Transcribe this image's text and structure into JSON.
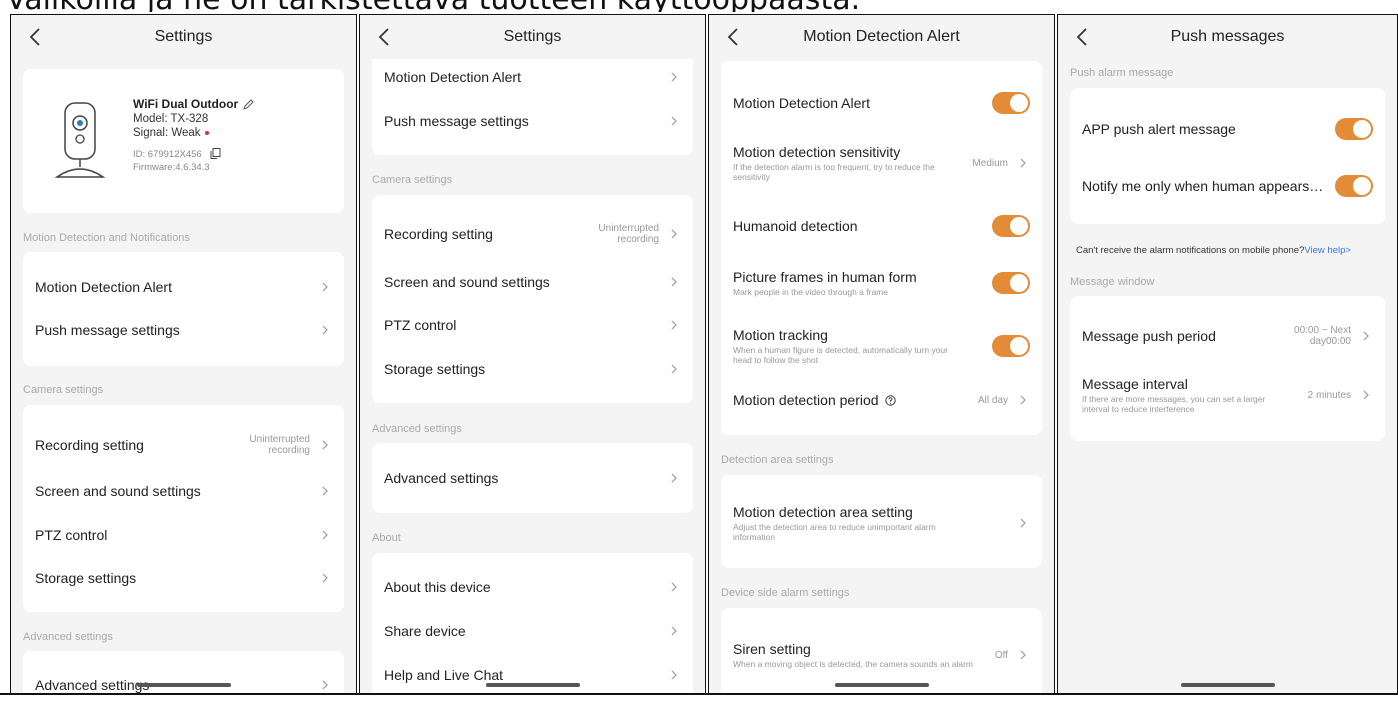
{
  "caption": "Valikoilla ja ne on tarkistettava tuotteen käyttöoppaasta.",
  "screens": {
    "s1": {
      "title": "Settings",
      "device": {
        "name": "WiFi Dual Outdoor",
        "model": "Model: TX-328",
        "signal": "Signal: Weak",
        "id": "ID: 679912X456",
        "firmware": "Firmware:4.6.34.3"
      },
      "sections": [
        "Motion Detection and Notifications",
        "Camera settings",
        "Advanced settings"
      ],
      "items": {
        "motion": "Motion Detection Alert",
        "push": "Push message settings",
        "recording": "Recording setting",
        "recording_value": "Uninterrupted recording",
        "screen": "Screen and sound settings",
        "ptz": "PTZ control",
        "storage": "Storage settings",
        "advanced": "Advanced settings"
      }
    },
    "s2": {
      "title": "Settings",
      "sections": [
        "Camera settings",
        "Advanced settings",
        "About"
      ],
      "items": {
        "motion": "Motion Detection Alert",
        "push": "Push message settings",
        "recording": "Recording setting",
        "recording_value": "Uninterrupted recording",
        "screen": "Screen and sound settings",
        "ptz": "PTZ control",
        "storage": "Storage settings",
        "advanced": "Advanced settings",
        "about": "About this device",
        "share": "Share device",
        "help": "Help and Live Chat"
      }
    },
    "s3": {
      "title": "Motion Detection Alert",
      "sections": [
        "Detection area settings",
        "Device side alarm settings"
      ],
      "items": {
        "alert": "Motion Detection Alert",
        "sensitivity": "Motion detection sensitivity",
        "sensitivity_sub": "If the detection alarm is too frequent, try to reduce the sensitivity",
        "sensitivity_value": "Medium",
        "humanoid": "Humanoid detection",
        "frames": "Picture frames in human form",
        "frames_sub": "Mark people in the video through a frame",
        "tracking": "Motion tracking",
        "tracking_sub": "When a human figure is detected, automatically turn your head to follow the shot",
        "period": "Motion detection period",
        "period_value": "All day",
        "area": "Motion detection area setting",
        "area_sub": "Adjust the detection area to reduce unimportant alarm information",
        "siren": "Siren setting",
        "siren_sub": "When a moving object is detected, the camera sounds an alarm",
        "siren_value": "Off"
      },
      "toggles": {
        "alert": true,
        "humanoid": true,
        "frames": true,
        "tracking": true
      }
    },
    "s4": {
      "title": "Push messages",
      "sections": [
        "Push alarm message",
        "Message window"
      ],
      "items": {
        "app_push": "APP push alert message",
        "notify_human": "Notify me only when human appears o...",
        "help_text": "Can't receive the alarm notifications on mobile phone?",
        "help_link": "View help>",
        "push_period": "Message push period",
        "push_period_value": "00:00 ~ Next day00:00",
        "interval": "Message interval",
        "interval_sub": "If there are more messages, you can set a larger interval to reduce interference",
        "interval_value": "2 minutes"
      },
      "toggles": {
        "app_push": true,
        "notify_human": true
      }
    }
  },
  "colors": {
    "accent": "#e38b37",
    "link": "#3a7bd5",
    "background": "#f4f4f4",
    "card": "#ffffff"
  }
}
